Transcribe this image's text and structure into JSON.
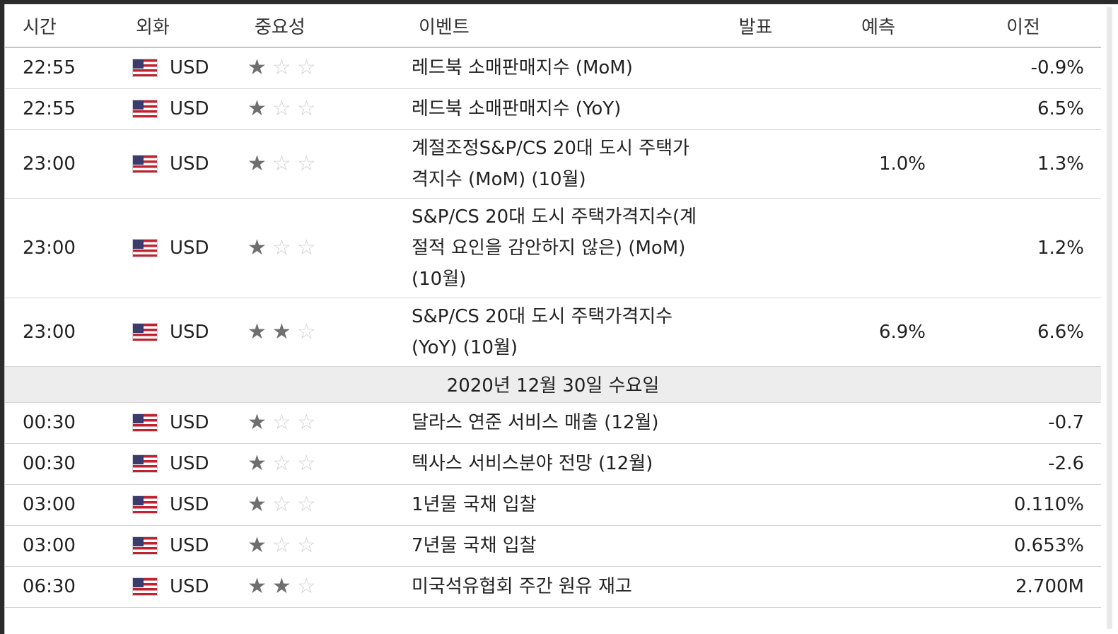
{
  "header": {
    "time": "시간",
    "currency": "외화",
    "importance": "중요성",
    "event": "이벤트",
    "actual": "발표",
    "forecast": "예측",
    "previous": "이전"
  },
  "rows": [
    {
      "time": "22:55",
      "currency": "USD",
      "importance": 1,
      "event": "레드북 소매판매지수 (MoM)",
      "actual": "",
      "forecast": "",
      "previous": "-0.9%"
    },
    {
      "time": "22:55",
      "currency": "USD",
      "importance": 1,
      "event": "레드북 소매판매지수 (YoY)",
      "actual": "",
      "forecast": "",
      "previous": "6.5%"
    },
    {
      "time": "23:00",
      "currency": "USD",
      "importance": 1,
      "event": "계절조정S&P/CS 20대 도시 주택가격지수 (MoM) (10월)",
      "actual": "",
      "forecast": "1.0%",
      "previous": "1.3%"
    },
    {
      "time": "23:00",
      "currency": "USD",
      "importance": 1,
      "event": "S&P/CS 20대 도시 주택가격지수(계절적 요인을 감안하지 않은) (MoM) (10월)",
      "actual": "",
      "forecast": "",
      "previous": "1.2%"
    },
    {
      "time": "23:00",
      "currency": "USD",
      "importance": 2,
      "event": "S&P/CS 20대 도시 주택가격지수 (YoY) (10월)",
      "actual": "",
      "forecast": "6.9%",
      "previous": "6.6%"
    },
    {
      "date": "2020년 12월 30일 수요일"
    },
    {
      "time": "00:30",
      "currency": "USD",
      "importance": 1,
      "event": "달라스 연준 서비스 매출 (12월)",
      "actual": "",
      "forecast": "",
      "previous": "-0.7"
    },
    {
      "time": "00:30",
      "currency": "USD",
      "importance": 1,
      "event": "텍사스 서비스분야 전망 (12월)",
      "actual": "",
      "forecast": "",
      "previous": "-2.6"
    },
    {
      "time": "03:00",
      "currency": "USD",
      "importance": 1,
      "event": "1년물 국채 입찰",
      "actual": "",
      "forecast": "",
      "previous": "0.110%"
    },
    {
      "time": "03:00",
      "currency": "USD",
      "importance": 1,
      "event": "7년물 국채 입찰",
      "actual": "",
      "forecast": "",
      "previous": "0.653%"
    },
    {
      "time": "06:30",
      "currency": "USD",
      "importance": 2,
      "event": "미국석유협회 주간 원유 재고",
      "actual": "",
      "forecast": "",
      "previous": "2.700M"
    }
  ],
  "icons": {
    "flag": "us-flag-icon",
    "star": "star-icon"
  },
  "colors": {
    "star_on": "#6f6f6f",
    "star_off": "#d2d2d2",
    "date_row_bg": "#ededed",
    "flag_red": "#c0232f",
    "flag_blue": "#3c3b6e"
  }
}
